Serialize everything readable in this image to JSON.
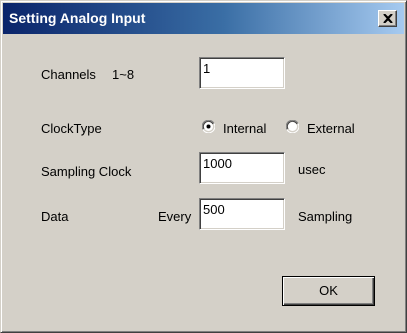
{
  "window": {
    "title": "Setting Analog Input",
    "close_glyph": "close-icon"
  },
  "channels": {
    "label": "Channels",
    "range": "1~8",
    "value": "1"
  },
  "clock_type": {
    "label": "ClockType",
    "options": [
      {
        "label": "Internal",
        "selected": true
      },
      {
        "label": "External",
        "selected": false
      }
    ]
  },
  "sampling_clock": {
    "label": "Sampling Clock",
    "value": "1000",
    "unit": "usec"
  },
  "data": {
    "label": "Data",
    "every_label": "Every",
    "value": "500",
    "unit": "Sampling"
  },
  "buttons": {
    "ok": "OK"
  },
  "colors": {
    "face": "#d4d0c8",
    "title_start": "#0a246a",
    "title_end": "#a6caf0"
  }
}
